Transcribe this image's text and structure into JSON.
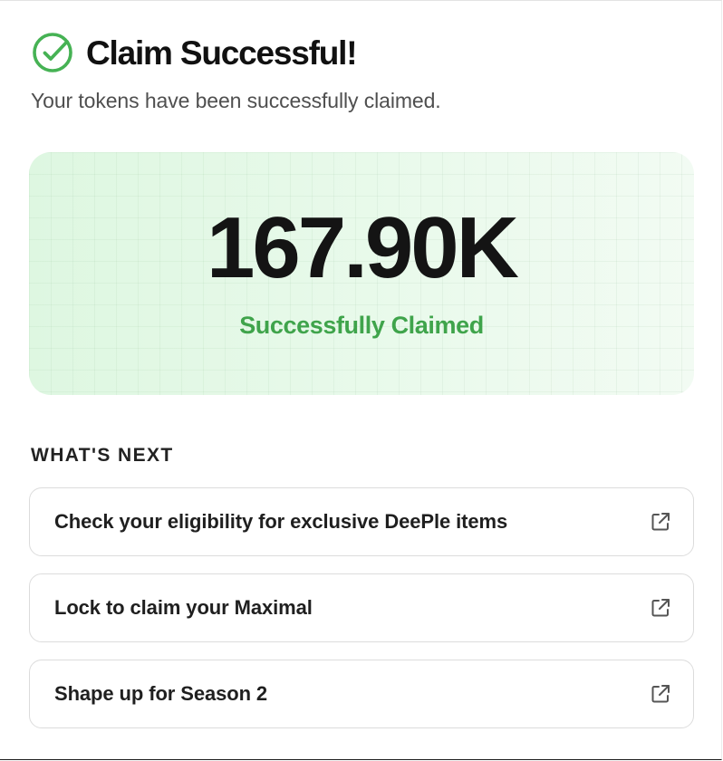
{
  "header": {
    "title": "Claim Successful!",
    "subtitle": "Your tokens have been successfully claimed.",
    "icon": "check-circle-icon"
  },
  "summary": {
    "amount": "167.90K",
    "status": "Successfully Claimed"
  },
  "next": {
    "heading": "WHAT'S NEXT",
    "items": [
      {
        "label": "Check your eligibility for exclusive DeePle items",
        "icon": "external-link-icon"
      },
      {
        "label": "Lock to claim your Maximal",
        "icon": "external-link-icon"
      },
      {
        "label": "Shape up for Season 2",
        "icon": "external-link-icon"
      }
    ]
  },
  "colors": {
    "accent_green": "#3fa44b",
    "hero_background": "#e3f8e5",
    "title_text": "#111111"
  }
}
